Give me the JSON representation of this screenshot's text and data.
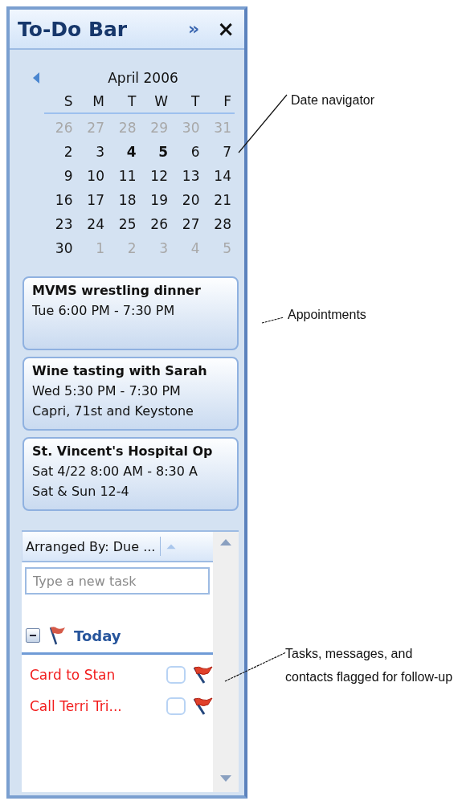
{
  "pane": {
    "title": "To-Do Bar",
    "expand_glyph": "»",
    "close_glyph": "×"
  },
  "date_navigator": {
    "month": "April 2006",
    "weekdays": [
      "S",
      "M",
      "T",
      "W",
      "T",
      "F"
    ],
    "weeks": [
      [
        {
          "day": "26",
          "in_month": false,
          "bold": false
        },
        {
          "day": "27",
          "in_month": false,
          "bold": false
        },
        {
          "day": "28",
          "in_month": false,
          "bold": false
        },
        {
          "day": "29",
          "in_month": false,
          "bold": false
        },
        {
          "day": "30",
          "in_month": false,
          "bold": false
        },
        {
          "day": "31",
          "in_month": false,
          "bold": false
        }
      ],
      [
        {
          "day": "2",
          "in_month": true,
          "bold": false
        },
        {
          "day": "3",
          "in_month": true,
          "bold": false
        },
        {
          "day": "4",
          "in_month": true,
          "bold": true
        },
        {
          "day": "5",
          "in_month": true,
          "bold": true
        },
        {
          "day": "6",
          "in_month": true,
          "bold": false
        },
        {
          "day": "7",
          "in_month": true,
          "bold": false
        }
      ],
      [
        {
          "day": "9",
          "in_month": true,
          "bold": false
        },
        {
          "day": "10",
          "in_month": true,
          "bold": false
        },
        {
          "day": "11",
          "in_month": true,
          "bold": false
        },
        {
          "day": "12",
          "in_month": true,
          "bold": false
        },
        {
          "day": "13",
          "in_month": true,
          "bold": false
        },
        {
          "day": "14",
          "in_month": true,
          "bold": false
        }
      ],
      [
        {
          "day": "16",
          "in_month": true,
          "bold": false
        },
        {
          "day": "17",
          "in_month": true,
          "bold": false
        },
        {
          "day": "18",
          "in_month": true,
          "bold": false
        },
        {
          "day": "19",
          "in_month": true,
          "bold": false
        },
        {
          "day": "20",
          "in_month": true,
          "bold": false
        },
        {
          "day": "21",
          "in_month": true,
          "bold": false
        }
      ],
      [
        {
          "day": "23",
          "in_month": true,
          "bold": false
        },
        {
          "day": "24",
          "in_month": true,
          "bold": false
        },
        {
          "day": "25",
          "in_month": true,
          "bold": false
        },
        {
          "day": "26",
          "in_month": true,
          "bold": false
        },
        {
          "day": "27",
          "in_month": true,
          "bold": false
        },
        {
          "day": "28",
          "in_month": true,
          "bold": false
        }
      ],
      [
        {
          "day": "30",
          "in_month": true,
          "bold": false
        },
        {
          "day": "1",
          "in_month": false,
          "bold": false
        },
        {
          "day": "2",
          "in_month": false,
          "bold": false
        },
        {
          "day": "3",
          "in_month": false,
          "bold": false
        },
        {
          "day": "4",
          "in_month": false,
          "bold": false
        },
        {
          "day": "5",
          "in_month": false,
          "bold": false
        }
      ]
    ]
  },
  "appointments": [
    {
      "title": "MVMS wrestling dinner",
      "lines": [
        "Tue 6:00 PM - 7:30 PM"
      ]
    },
    {
      "title": "Wine tasting with Sarah",
      "lines": [
        "Wed 5:30 PM - 7:30 PM",
        "Capri, 71st and Keystone"
      ]
    },
    {
      "title": "St. Vincent's Hospital Op",
      "lines": [
        "Sat 4/22 8:00 AM - 8:30 A",
        "Sat & Sun 12-4"
      ]
    }
  ],
  "task_list": {
    "arranged_by": "Arranged By: Due ...",
    "placeholder": "Type a new task",
    "groups": [
      {
        "label": "Today",
        "expanded": true,
        "tasks": [
          {
            "name": "Card to Stan",
            "checked": false,
            "flagged": true
          },
          {
            "name": "Call Terri Tri...",
            "checked": false,
            "flagged": true
          }
        ]
      }
    ]
  },
  "annotations": [
    {
      "text": "Date navigator"
    },
    {
      "text": "Appointments"
    },
    {
      "text": "Tasks, messages, and contacts flagged for follow-up"
    }
  ]
}
